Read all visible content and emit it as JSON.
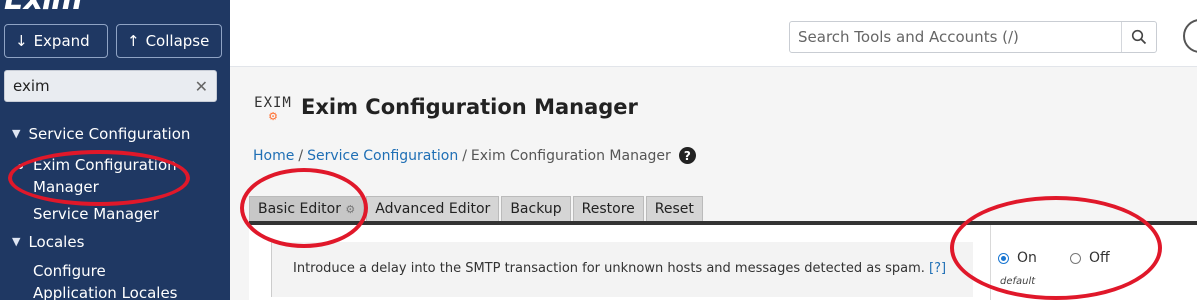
{
  "sidebar": {
    "logo_text": "Exim",
    "expand_label": "Expand",
    "collapse_label": "Collapse",
    "search_value": "exim",
    "nav": [
      {
        "label": "Service Configuration",
        "type": "section"
      },
      {
        "label": "Exim Configuration Manager",
        "type": "link",
        "active": true
      },
      {
        "label": "Service Manager",
        "type": "link"
      },
      {
        "label": "Locales",
        "type": "section"
      },
      {
        "label": "Configure Application Locales",
        "type": "link"
      }
    ]
  },
  "topbar": {
    "search_placeholder": "Search Tools and Accounts (/)"
  },
  "page": {
    "logo_word": "EXIM",
    "title": "Exim Configuration Manager",
    "breadcrumb": {
      "home": "Home",
      "sep": "/",
      "parent": "Service Configuration",
      "current": "Exim Configuration Manager"
    },
    "tabs": [
      "Basic Editor",
      "Advanced Editor",
      "Backup",
      "Restore",
      "Reset"
    ],
    "setting": {
      "description": "Introduce a delay into the SMTP transaction for unknown hosts and messages detected as spam.",
      "help_link": "[?]",
      "option_on": "On",
      "option_off": "Off",
      "default_label": "default",
      "selected": "On"
    }
  },
  "colors": {
    "sidebar_bg": "#1f3863",
    "link": "#1f6fb5",
    "annotation": "#e0182a",
    "exim_orange": "#ff6c2c"
  }
}
